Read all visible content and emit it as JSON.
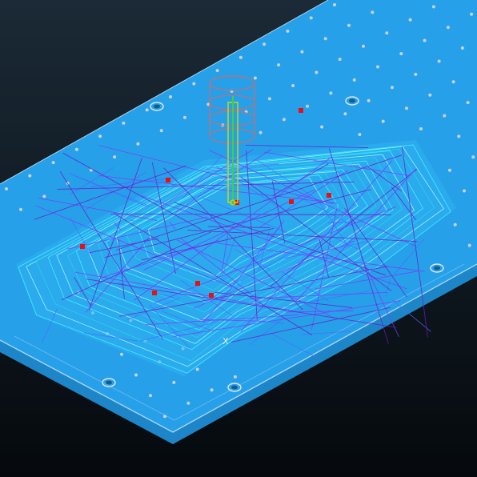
{
  "view": {
    "type": "cam-toolpath-3d-view",
    "projection": "isometric"
  },
  "colors": {
    "background_top": "#1b2a36",
    "background_bottom": "#05090d",
    "fixture_plate": "#27a0ea",
    "fixture_plate_side": "#1d86c8",
    "fixture_edge": "#a9d4f2",
    "bolt_hole": "#c9d2dc",
    "stock_part": "#2fb3f0",
    "toolpath_cyan": "#3cf0ff",
    "toolpath_violet": "#7a3cff",
    "toolpath_blue": "#4a6cff",
    "rapid_moves": "#6a1cc8",
    "tool_holder": "#d06a6a",
    "tool_shank": "#d6d600",
    "tool_spindle_axis": "#40d040",
    "marker_points": "#e81010"
  },
  "toolpath": {
    "marker_count": 9
  },
  "tool": {
    "icon": "end-mill-tool-icon"
  },
  "labels": {
    "axis_marker": "X"
  }
}
